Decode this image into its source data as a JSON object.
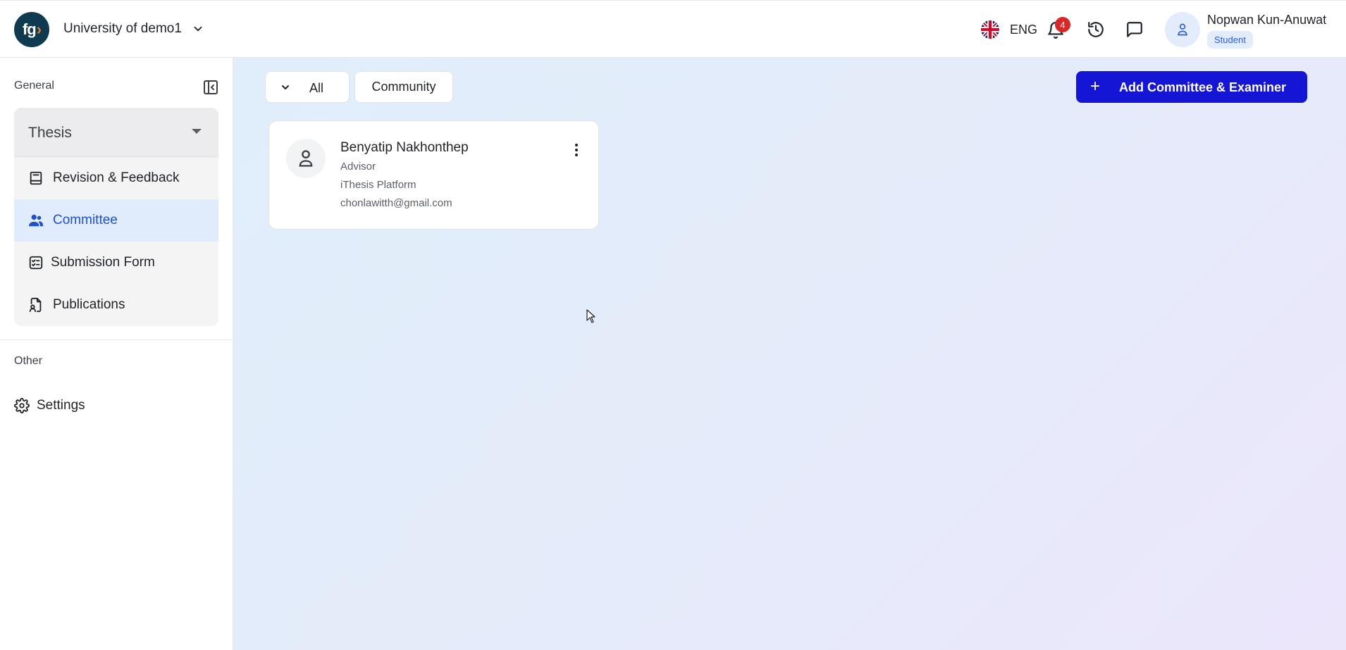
{
  "header": {
    "logo_text": "fg",
    "organization": "University of demo1",
    "language": "ENG",
    "notifications_count": "4",
    "user_name": "Nopwan Kun-Anuwat",
    "user_role": "Student"
  },
  "sidebar": {
    "general_title": "General",
    "thesis_label": "Thesis",
    "items": [
      {
        "label": "Revision & Feedback",
        "icon": "book-icon"
      },
      {
        "label": "Committee",
        "icon": "users-icon",
        "active": true
      },
      {
        "label": "Submission Form",
        "icon": "checklist-icon"
      },
      {
        "label": "Publications",
        "icon": "document-user-icon"
      }
    ],
    "other_title": "Other",
    "settings_label": "Settings"
  },
  "main": {
    "filter_all": "All",
    "filter_community": "Community",
    "add_button": "Add Committee & Examiner",
    "cards": [
      {
        "name": "Benyatip Nakhonthep",
        "role": "Advisor",
        "platform": "iThesis Platform",
        "email": "chonlawitth@gmail.com"
      }
    ]
  },
  "colors": {
    "primary": "#1515d6",
    "active_text": "#1e51c9",
    "active_bg": "#e0ecfb",
    "badge": "#d62828",
    "logo_bg": "#0f3a4f"
  }
}
